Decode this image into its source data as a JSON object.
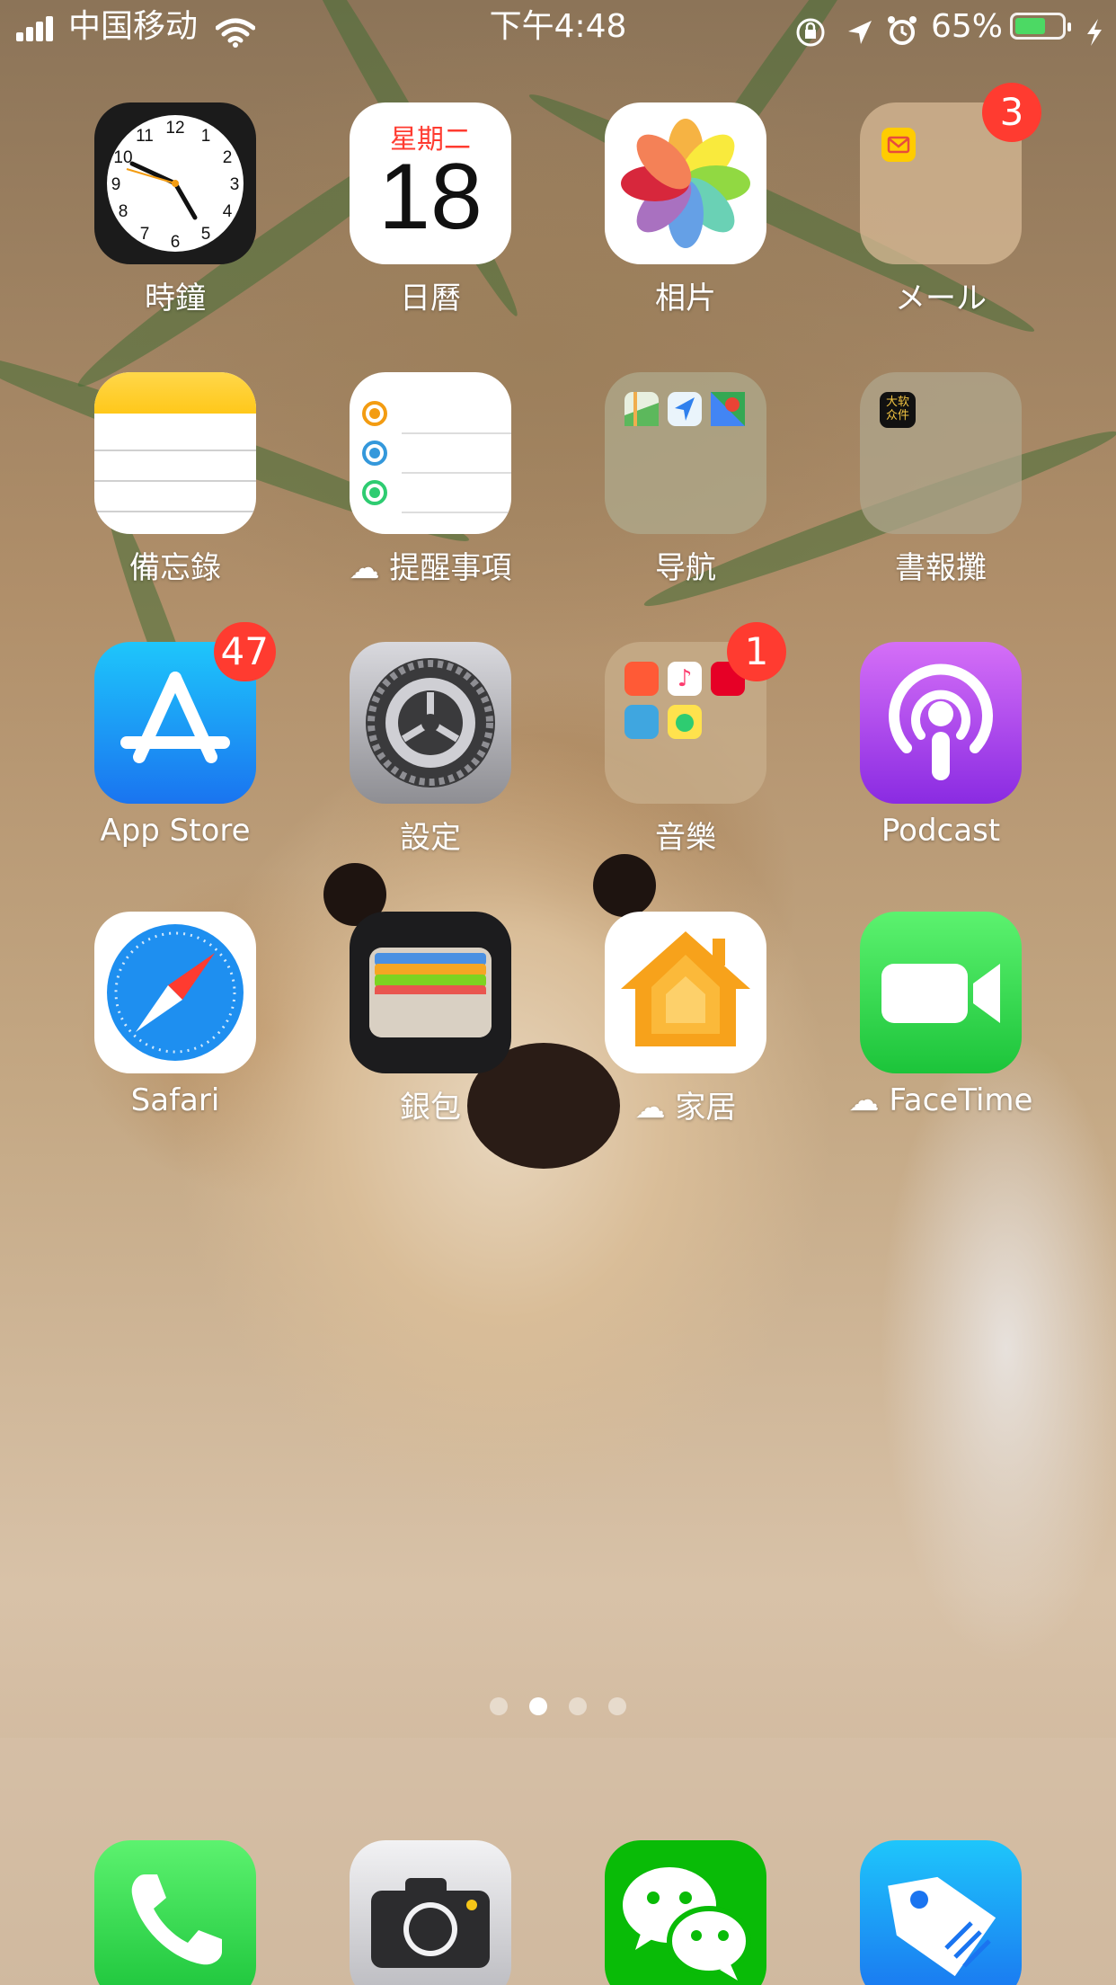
{
  "status_bar": {
    "carrier": "中国移动",
    "time": "下午4:48",
    "battery_percent": "65%",
    "battery_level": 0.65,
    "icons": [
      "signal-bars-icon",
      "wifi-icon",
      "orientation-lock-icon",
      "location-arrow-icon",
      "alarm-clock-icon",
      "battery-icon",
      "charging-bolt-icon"
    ]
  },
  "apps": [
    {
      "label": "時鐘",
      "icon": "clock-icon"
    },
    {
      "label": "日曆",
      "icon": "calendar-icon",
      "weekday": "星期二",
      "day": "18"
    },
    {
      "label": "相片",
      "icon": "photos-icon"
    },
    {
      "label": "メール",
      "icon": "folder-icon",
      "badge": "3"
    },
    {
      "label": "備忘錄",
      "icon": "notes-icon"
    },
    {
      "label": "提醒事項",
      "icon": "reminders-icon",
      "cloud": true
    },
    {
      "label": "导航",
      "icon": "folder-icon"
    },
    {
      "label": "書報攤",
      "icon": "folder-icon",
      "mini_text": "大软\n众件"
    },
    {
      "label": "App Store",
      "icon": "app-store-icon",
      "badge": "47"
    },
    {
      "label": "設定",
      "icon": "settings-gear-icon"
    },
    {
      "label": "音樂",
      "icon": "folder-icon",
      "badge": "1"
    },
    {
      "label": "Podcast",
      "icon": "podcast-icon"
    },
    {
      "label": "Safari",
      "icon": "safari-compass-icon"
    },
    {
      "label": "銀包",
      "icon": "wallet-icon"
    },
    {
      "label": "家居",
      "icon": "home-house-icon",
      "cloud": true
    },
    {
      "label": "FaceTime",
      "icon": "facetime-camera-icon",
      "cloud": true
    }
  ],
  "page_dots": {
    "count": 4,
    "active": 1
  },
  "dock": [
    {
      "icon": "phone-icon"
    },
    {
      "icon": "camera-icon"
    },
    {
      "icon": "wechat-icon"
    },
    {
      "icon": "price-tag-icon"
    }
  ],
  "colors": {
    "badge": "#ff3b30",
    "battery_fill": "#4cd964"
  }
}
